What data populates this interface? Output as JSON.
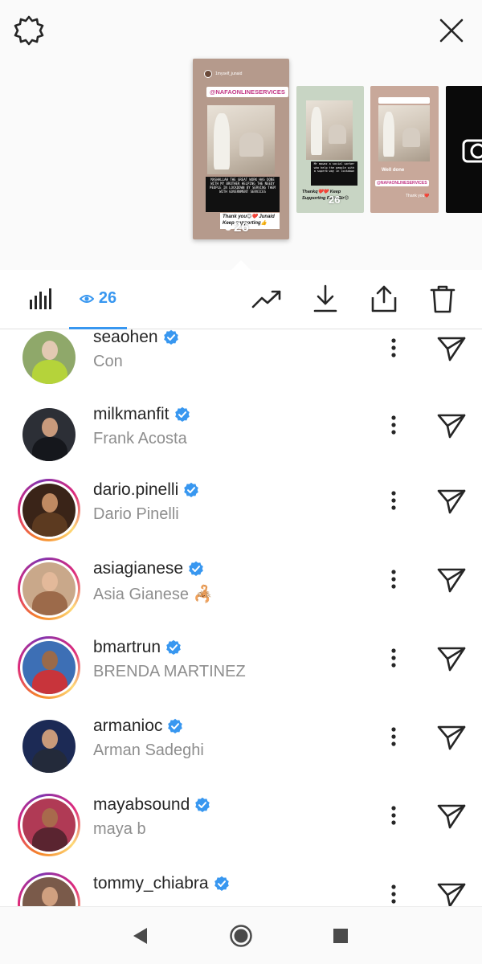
{
  "tray": {
    "main_story": {
      "username": "1myself_junaid",
      "tag": "@NAFAONLINESERVICES",
      "caption": "MASHALLAH THE GREAT WORK HAS DONE WITH MY BROTHER HELPING THE NEEDY PEOPLE IN LOCKDOWN BY SERVING THEM WITH GOVERNMENT SERVICES",
      "sticker": "Thank you😊❤️ Junaid Keep supporting👍",
      "views": "26"
    },
    "story_2": {
      "caption": "Mr mowaz a social worker who help the people with a superb way in lockdown",
      "sticker": "Thankq❤️❤️ Keep Supporting Fe in Sir😊",
      "views": "26"
    },
    "story_3": {
      "sticker": "Well done",
      "tag": "@NAFAONLINESERVICES",
      "note": "Thank you❤️"
    }
  },
  "toolbar": {
    "viewer_count": "26"
  },
  "viewers": [
    {
      "username": "seaohen",
      "full_name": "Con",
      "ring": false,
      "bg": "#8fa86a",
      "head": "#e2c9b2",
      "body": "#b5d33a"
    },
    {
      "username": "milkmanfit",
      "full_name": "Frank Acosta",
      "ring": false,
      "bg": "#2c2f36",
      "head": "#c89a7c",
      "body": "#15171c"
    },
    {
      "username": "dario.pinelli",
      "full_name": "Dario Pinelli",
      "ring": true,
      "bg": "#3a2418",
      "head": "#c08a62",
      "body": "#5c3a20"
    },
    {
      "username": "asiagianese",
      "full_name": "Asia Gianese 🦂",
      "ring": true,
      "bg": "#c9a88a",
      "head": "#e3b99a",
      "body": "#9c6a4a"
    },
    {
      "username": "bmartrun",
      "full_name": "BRENDA MARTINEZ",
      "ring": true,
      "bg": "#3d6fb5",
      "head": "#9a6a4a",
      "body": "#c8343b"
    },
    {
      "username": "armanioc",
      "full_name": "Arman Sadeghi",
      "ring": false,
      "bg": "#1c2a55",
      "head": "#c99a7a",
      "body": "#232a3a"
    },
    {
      "username": "mayabsound",
      "full_name": "maya b",
      "ring": true,
      "bg": "#b03a55",
      "head": "#a86a4c",
      "body": "#5a2430"
    },
    {
      "username": "tommy_chiabra",
      "full_name": "",
      "ring": true,
      "bg": "#7a5a4a",
      "head": "#d0a080",
      "body": "#2a2a2a"
    }
  ],
  "colors": {
    "accent": "#3897f0",
    "verified": "#3897f0",
    "secondary_text": "#8e8e8e"
  },
  "icons": {
    "settings": "gear-icon",
    "close": "close-icon",
    "insights": "bar-chart-icon",
    "viewers": "eye-icon",
    "promote": "trending-up-icon",
    "download": "download-icon",
    "share": "share-icon",
    "delete": "trash-icon",
    "more": "more-vertical-icon",
    "send": "send-icon"
  }
}
